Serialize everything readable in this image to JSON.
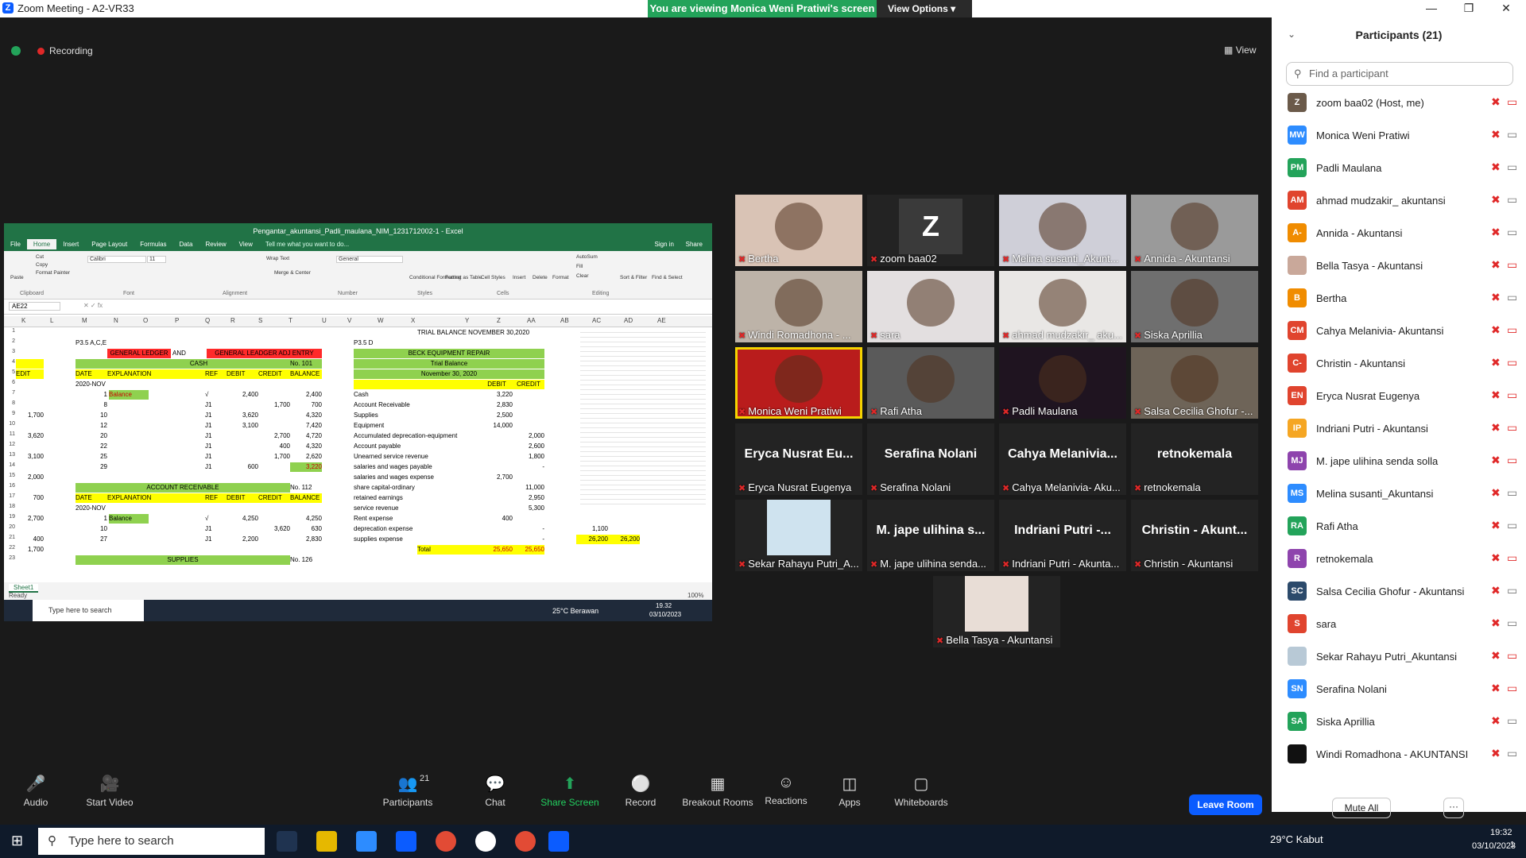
{
  "window": {
    "title": "Zoom Meeting - A2-VR33",
    "viewing_banner": "You are viewing Monica Weni Pratiwi's screen",
    "view_options": "View Options"
  },
  "status": {
    "recording": "Recording",
    "view_label": "View"
  },
  "shared_screen": {
    "excel_title": "Pengantar_akuntansi_Padli_maulana_NIM_1231712002-1 - Excel",
    "tabs": [
      "File",
      "Home",
      "Insert",
      "Page Layout",
      "Formulas",
      "Data",
      "Review",
      "View"
    ],
    "tell_me": "Tell me what you want to do...",
    "sign_in": "Sign in",
    "share": "Share",
    "name_box": "AE22",
    "font_name": "Calibri",
    "font_size": "11",
    "number_format": "General",
    "ribbon_groups": [
      "Clipboard",
      "Font",
      "Alignment",
      "Number",
      "Styles",
      "Cells",
      "Editing"
    ],
    "ribbon_buttons": [
      "Paste",
      "Cut",
      "Copy",
      "Format Painter",
      "Wrap Text",
      "Merge & Center",
      "Conditional Formatting",
      "Format as Table",
      "Cell Styles",
      "Insert",
      "Delete",
      "Format",
      "AutoSum",
      "Fill",
      "Clear",
      "Sort & Filter",
      "Find & Select"
    ],
    "col_headers": [
      "K",
      "L",
      "M",
      "N",
      "O",
      "P",
      "Q",
      "R",
      "S",
      "T",
      "U",
      "V",
      "W",
      "X",
      "Y",
      "Z",
      "AA",
      "AB",
      "AC",
      "AD",
      "AE"
    ],
    "row_numbers": [
      "1",
      "2",
      "3",
      "4",
      "5",
      "6",
      "7",
      "8",
      "9",
      "10",
      "11",
      "12",
      "13",
      "14",
      "15",
      "16",
      "17",
      "18",
      "19",
      "20",
      "21",
      "22",
      "23"
    ],
    "ledger": {
      "label_p": "P3.5 A,C,E",
      "general_ledger": "GENERAL LEDGER",
      "and": "AND",
      "general_ledger_adj": "GENERAL LEADGER ADJ ENTRY",
      "cash_title": "CASH",
      "cash_no": "No. 101",
      "headers": [
        "DATE",
        "EXPLANATION",
        "REF",
        "DEBIT",
        "CREDIT",
        "BALANCE"
      ],
      "period": "2020-NOV",
      "cash_rows": [
        {
          "day": "1",
          "exp": "Balance",
          "ref": "√",
          "debit": "2,400",
          "credit": "",
          "bal": "2,400"
        },
        {
          "day": "8",
          "exp": "",
          "ref": "J1",
          "debit": "",
          "credit": "1,700",
          "bal": "700"
        },
        {
          "day": "10",
          "exp": "",
          "ref": "J1",
          "debit": "3,620",
          "credit": "",
          "bal": "4,320"
        },
        {
          "day": "12",
          "exp": "",
          "ref": "J1",
          "debit": "3,100",
          "credit": "",
          "bal": "7,420"
        },
        {
          "day": "20",
          "exp": "",
          "ref": "J1",
          "debit": "",
          "credit": "2,700",
          "bal": "4,720"
        },
        {
          "day": "22",
          "exp": "",
          "ref": "J1",
          "debit": "",
          "credit": "400",
          "bal": "4,320"
        },
        {
          "day": "25",
          "exp": "",
          "ref": "J1",
          "debit": "",
          "credit": "1,700",
          "bal": "2,620"
        },
        {
          "day": "29",
          "exp": "",
          "ref": "J1",
          "debit": "600",
          "credit": "",
          "bal": "3,220"
        }
      ],
      "left_col": [
        "",
        "",
        "1,700",
        "",
        "3,620",
        "",
        "3,100",
        "",
        "2,000",
        "",
        "700",
        "",
        "2,700",
        "",
        "400",
        "1,700"
      ],
      "ar_title": "ACCOUNT RECEIVABLE",
      "ar_no": "No. 112",
      "ar_rows": [
        {
          "day": "1",
          "exp": "Balance",
          "ref": "√",
          "debit": "4,250",
          "credit": "",
          "bal": "4,250"
        },
        {
          "day": "10",
          "exp": "",
          "ref": "J1",
          "debit": "",
          "credit": "3,620",
          "bal": "630"
        },
        {
          "day": "27",
          "exp": "",
          "ref": "J1",
          "debit": "2,200",
          "credit": "",
          "bal": "2,830"
        }
      ],
      "supplies_title": "SUPPLIES",
      "supplies_no": "No. 126"
    },
    "trial_balance": {
      "heading": "TRIAL BALANCE NOVEMBER 30,2020",
      "label_p": "P3.5 D",
      "company": "BECK EQUIPMENT REPAIR",
      "subtitle": "Trial Balance",
      "date": "November 30, 2020",
      "debit_h": "DEBIT",
      "credit_h": "CREDIT",
      "rows": [
        {
          "acct": "Cash",
          "debit": "3,220",
          "credit": ""
        },
        {
          "acct": "Account Receivable",
          "debit": "2,830",
          "credit": ""
        },
        {
          "acct": "Supplies",
          "debit": "2,500",
          "credit": ""
        },
        {
          "acct": "Equipment",
          "debit": "14,000",
          "credit": ""
        },
        {
          "acct": "Accumulated deprecation-equipment",
          "debit": "",
          "credit": "2,000"
        },
        {
          "acct": "Account payable",
          "debit": "",
          "credit": "2,600"
        },
        {
          "acct": "Unearned service revenue",
          "debit": "",
          "credit": "1,800"
        },
        {
          "acct": "salaries and wages payable",
          "debit": "",
          "credit": "-"
        },
        {
          "acct": "salaries and wages expense",
          "debit": "2,700",
          "credit": ""
        },
        {
          "acct": "share capital-ordinary",
          "debit": "",
          "credit": "11,000"
        },
        {
          "acct": "retained earnings",
          "debit": "",
          "credit": "2,950"
        },
        {
          "acct": "service revenue",
          "debit": "",
          "credit": "5,300"
        },
        {
          "acct": "Rent expense",
          "debit": "400",
          "credit": ""
        },
        {
          "acct": "deprecation expense",
          "debit": "",
          "credit": "-"
        },
        {
          "acct": "supplies expense",
          "debit": "",
          "credit": "-"
        }
      ],
      "total_label": "Total",
      "total_debit": "25,650",
      "total_credit": "25,650",
      "side_values": [
        "1,100",
        "26,200",
        "26,200"
      ]
    },
    "sheet_tab": "Sheet1",
    "status_ready": "Ready",
    "zoom_level": "100%",
    "taskbar_search": "Type here to search",
    "taskbar_weather": "25°C  Berawan",
    "taskbar_time": "19.32",
    "taskbar_date": "03/10/2023"
  },
  "tiles": [
    {
      "name": "Bertha",
      "type": "video",
      "color": "#d9c3b5"
    },
    {
      "name": "zoom baa02",
      "type": "letter",
      "letter": "Z",
      "color": "#3a3a3a"
    },
    {
      "name": "Melina susanti_Akunt...",
      "type": "video",
      "color": "#cfcfd8"
    },
    {
      "name": "Annida - Akuntansi",
      "type": "video",
      "color": "#9a9a9a"
    },
    {
      "name": "Windi Romadhona - ...",
      "type": "video",
      "color": "#bdb3a8"
    },
    {
      "name": "sara",
      "type": "video",
      "color": "#e3dfe0"
    },
    {
      "name": "ahmad mudzakir_ aku...",
      "type": "video",
      "color": "#e9e7e5"
    },
    {
      "name": "Siska Aprillia",
      "type": "video",
      "color": "#6f6f6f"
    },
    {
      "name": "Monica Weni Pratiwi",
      "type": "video",
      "color": "#b91c1c"
    },
    {
      "name": "Rafi Atha",
      "type": "video",
      "color": "#5a5a5a"
    },
    {
      "name": "Padli Maulana",
      "type": "video",
      "color": "#1f1420"
    },
    {
      "name": "Salsa Cecilia Ghofur -...",
      "type": "video",
      "color": "#6e6458"
    },
    {
      "name": "Eryca Nusrat Eugenya",
      "type": "name",
      "big": "Eryca Nusrat Eu..."
    },
    {
      "name": "Serafina Nolani",
      "type": "name",
      "big": "Serafina Nolani"
    },
    {
      "name": "Cahya Melanivia- Aku...",
      "type": "name",
      "big": "Cahya  Melanivia..."
    },
    {
      "name": "retnokemala",
      "type": "name",
      "big": "retnokemala"
    },
    {
      "name": "Sekar Rahayu Putri_A...",
      "type": "photo",
      "color": "#cfe3ef"
    },
    {
      "name": "M. jape ulihina senda...",
      "type": "name",
      "big": "M. jape ulihina s..."
    },
    {
      "name": "Indriani Putri - Akunta...",
      "type": "name",
      "big": "Indriani Putri -..."
    },
    {
      "name": "Christin - Akuntansi",
      "type": "name",
      "big": "Christin  - Akunt..."
    },
    {
      "name": "Bella Tasya - Akuntansi",
      "type": "photo",
      "color": "#e8ddd6"
    }
  ],
  "panel": {
    "title": "Participants (21)",
    "search_placeholder": "Find a participant",
    "participants": [
      {
        "initials": "Z",
        "name": "zoom baa02 (Host, me)",
        "color": "#6b5a4a",
        "cam": false
      },
      {
        "initials": "MW",
        "name": "Monica Weni Pratiwi",
        "color": "#2d8cff",
        "cam": true
      },
      {
        "initials": "PM",
        "name": "Padli Maulana",
        "color": "#23a35a",
        "cam": true
      },
      {
        "initials": "AM",
        "name": "ahmad mudzakir_ akuntansi",
        "color": "#e0442e",
        "cam": true
      },
      {
        "initials": "A-",
        "name": "Annida - Akuntansi",
        "color": "#f08c00",
        "cam": true
      },
      {
        "initials": "",
        "name": "Bella Tasya - Akuntansi",
        "color": "#c9a89a",
        "cam": false
      },
      {
        "initials": "B",
        "name": "Bertha",
        "color": "#f08c00",
        "cam": true
      },
      {
        "initials": "CM",
        "name": "Cahya Melanivia- Akuntansi",
        "color": "#e0442e",
        "cam": false
      },
      {
        "initials": "C-",
        "name": "Christin  - Akuntansi",
        "color": "#e0442e",
        "cam": false
      },
      {
        "initials": "EN",
        "name": "Eryca Nusrat Eugenya",
        "color": "#e0442e",
        "cam": false
      },
      {
        "initials": "IP",
        "name": "Indriani Putri - Akuntansi",
        "color": "#f5a623",
        "cam": false
      },
      {
        "initials": "MJ",
        "name": "M. jape ulihina senda solla",
        "color": "#8e44ad",
        "cam": false
      },
      {
        "initials": "MS",
        "name": "Melina susanti_Akuntansi",
        "color": "#2d8cff",
        "cam": true
      },
      {
        "initials": "RA",
        "name": "Rafi Atha",
        "color": "#23a35a",
        "cam": true
      },
      {
        "initials": "R",
        "name": "retnokemala",
        "color": "#8e44ad",
        "cam": false
      },
      {
        "initials": "SC",
        "name": "Salsa Cecilia Ghofur - Akuntansi",
        "color": "#2c4a6b",
        "cam": true
      },
      {
        "initials": "S",
        "name": "sara",
        "color": "#e0442e",
        "cam": true
      },
      {
        "initials": "",
        "name": "Sekar Rahayu Putri_Akuntansi",
        "color": "#b8c9d6",
        "cam": false
      },
      {
        "initials": "SN",
        "name": "Serafina Nolani",
        "color": "#2d8cff",
        "cam": false
      },
      {
        "initials": "SA",
        "name": "Siska Aprillia",
        "color": "#23a35a",
        "cam": true
      },
      {
        "initials": "",
        "name": "Windi Romadhona - AKUNTANSI",
        "color": "#111111",
        "cam": true
      }
    ],
    "mute_all": "Mute All",
    "more": "···"
  },
  "toolbar": {
    "audio": "Audio",
    "start_video": "Start Video",
    "participants": "Participants",
    "participants_count": "21",
    "chat": "Chat",
    "share_screen": "Share Screen",
    "record": "Record",
    "breakout": "Breakout Rooms",
    "reactions": "Reactions",
    "apps": "Apps",
    "whiteboards": "Whiteboards",
    "leave": "Leave Room"
  },
  "taskbar": {
    "search": "Type here to search",
    "weather": "29°C  Kabut",
    "time": "19:32",
    "date": "03/10/2023",
    "notif": "1"
  }
}
